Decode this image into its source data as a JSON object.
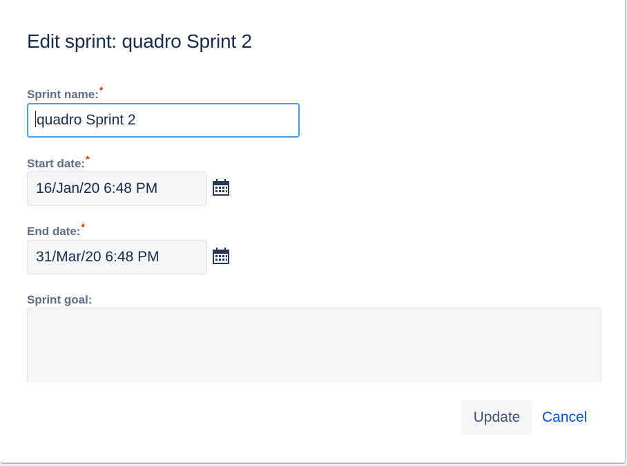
{
  "dialog": {
    "title": "Edit sprint: quadro Sprint 2"
  },
  "form": {
    "sprint_name": {
      "label": "Sprint name:",
      "required_mark": "*",
      "value": "quadro Sprint 2"
    },
    "start_date": {
      "label": "Start date:",
      "required_mark": "*",
      "value": "16/Jan/20 6:48 PM",
      "icon": "calendar-icon"
    },
    "end_date": {
      "label": "End date:",
      "required_mark": "*",
      "value": "31/Mar/20 6:48 PM",
      "icon": "calendar-icon"
    },
    "sprint_goal": {
      "label": "Sprint goal:",
      "value": ""
    }
  },
  "actions": {
    "update_label": "Update",
    "cancel_label": "Cancel"
  },
  "colors": {
    "focus_border": "#4c9aff",
    "required": "#de350b",
    "link": "#0052cc",
    "label": "#5e6c84",
    "title": "#172b4d"
  }
}
